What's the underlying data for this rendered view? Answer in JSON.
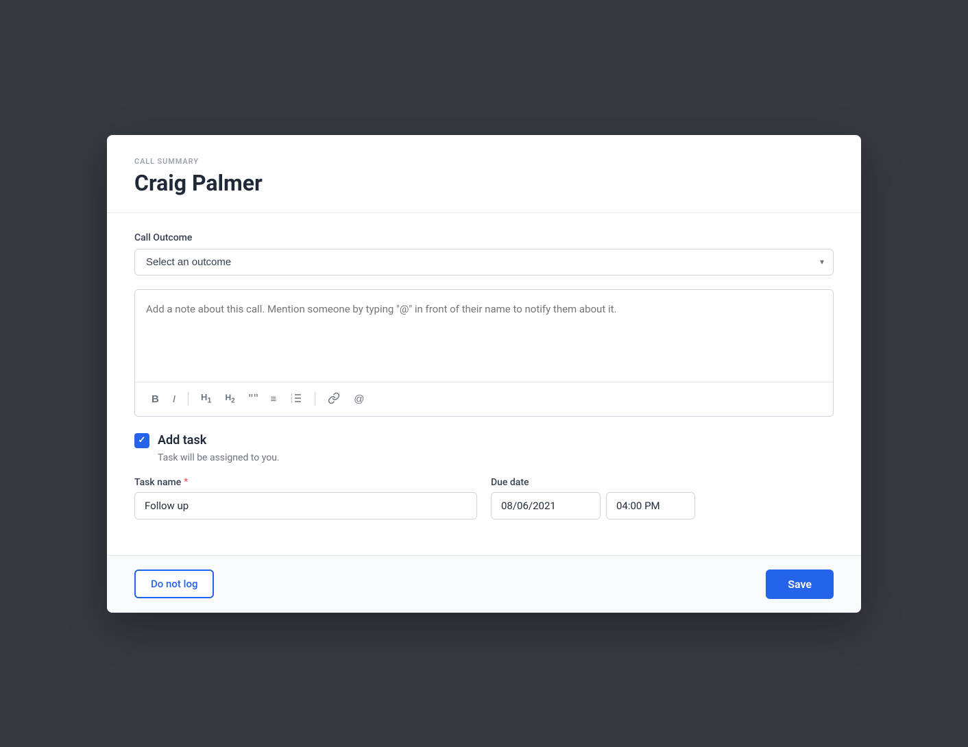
{
  "modal": {
    "header_label": "CALL SUMMARY",
    "title": "Craig Palmer",
    "call_outcome_label": "Call Outcome",
    "select_placeholder": "Select an outcome",
    "note_placeholder": "Add a note about this call. Mention someone by typing \"@\" in front of their name to notify them about it.",
    "toolbar": {
      "bold": "B",
      "italic": "I",
      "h1": "H₁",
      "h2": "H₂",
      "quote": "\"\"",
      "bullet_list": "≡",
      "ordered_list": "≡",
      "link": "🔗",
      "mention": "@"
    },
    "add_task": {
      "label": "Add task",
      "assigned_text": "Task will be assigned to you.",
      "task_name_label": "Task name",
      "due_date_label": "Due date",
      "task_name_value": "Follow up",
      "due_date_value": "08/06/2021",
      "due_time_value": "04:00 PM"
    },
    "footer": {
      "do_not_log_label": "Do not log",
      "save_label": "Save"
    }
  }
}
